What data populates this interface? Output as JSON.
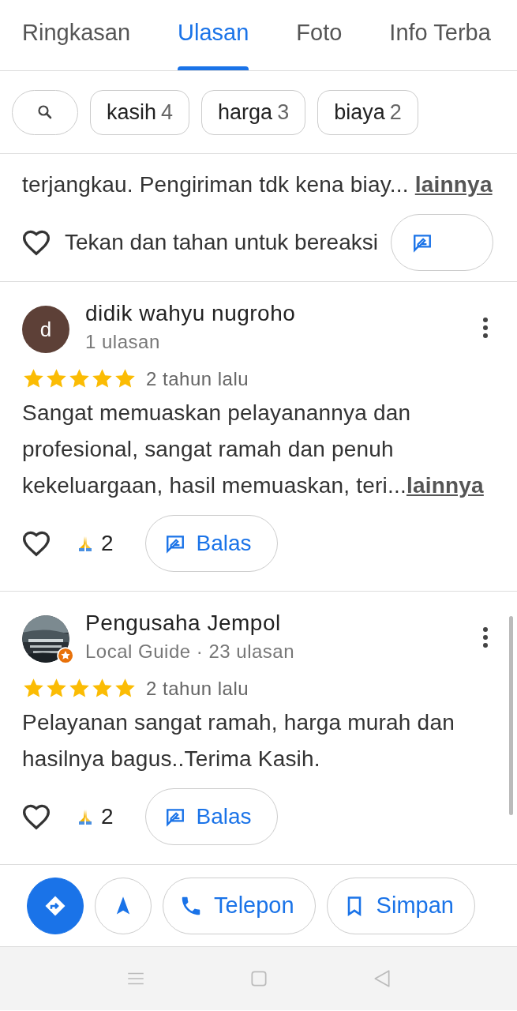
{
  "tabs": [
    {
      "label": "Ringkasan",
      "selected": false
    },
    {
      "label": "Ulasan",
      "selected": true
    },
    {
      "label": "Foto",
      "selected": false
    },
    {
      "label": "Info Terba",
      "selected": false
    }
  ],
  "filter_chips": [
    {
      "word": "kasih",
      "count": "4"
    },
    {
      "word": "harga",
      "count": "3"
    },
    {
      "word": "biaya",
      "count": "2"
    }
  ],
  "partial_review": {
    "text": "terjangkau. Pengiriman tdk kena biay...",
    "more": "lainnya",
    "reaction_hint": "Tekan dan tahan untuk bereaksi"
  },
  "reviews": [
    {
      "avatar": {
        "kind": "letter",
        "letter": "d",
        "color": "#5d4037"
      },
      "local_guide": false,
      "name": "didik wahyu nugroho",
      "meta": "1 ulasan",
      "stars": 5,
      "time": "2 tahun lalu",
      "text": "Sangat memuaskan pelayanannya dan profesional, sangat ramah dan penuh kekeluargaan, hasil memuaskan, teri...",
      "more": "lainnya",
      "reactions": "2",
      "reply": "Balas"
    },
    {
      "local_guide": true,
      "name": "Pengusaha Jempol",
      "meta": "Local Guide · 23 ulasan",
      "stars": 5,
      "time": "2 tahun lalu",
      "text": "Pelayanan sangat ramah, harga murah dan hasilnya bagus..Terima Kasih.",
      "reactions": "2",
      "reply": "Balas"
    }
  ],
  "actions": [
    {
      "kind": "directions"
    },
    {
      "kind": "start"
    },
    {
      "kind": "call",
      "label": "Telepon"
    },
    {
      "kind": "save",
      "label": "Simpan"
    }
  ]
}
